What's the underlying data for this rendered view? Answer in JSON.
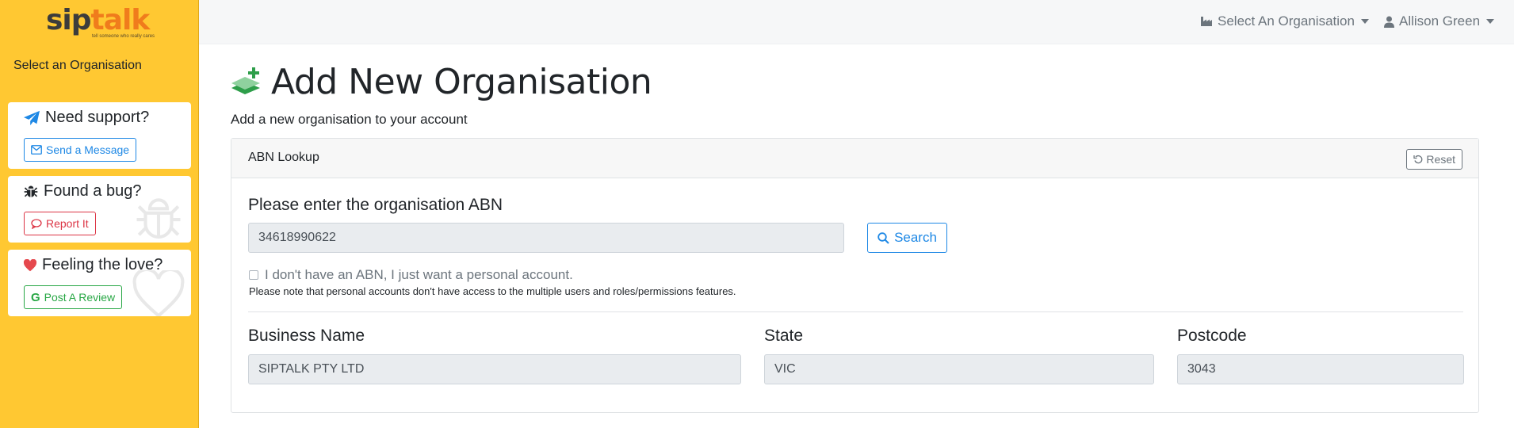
{
  "sidebar": {
    "logo": {
      "sip": "sip",
      "talk": "talk",
      "tagline": "tell someone who really cares"
    },
    "select_org_label": "Select an Organisation",
    "cards": {
      "support": {
        "title": "Need support?",
        "button": "Send a Message"
      },
      "bug": {
        "title": "Found a bug?",
        "button": "Report It"
      },
      "love": {
        "title": "Feeling the love?",
        "button": "Post A Review"
      }
    }
  },
  "topnav": {
    "org_menu": "Select An Organisation",
    "user_menu": "Allison Green"
  },
  "main": {
    "title": "Add New Organisation",
    "subtitle": "Add a new organisation to your account",
    "panel": {
      "header": "ABN Lookup",
      "reset_label": "Reset",
      "abn_heading": "Please enter the organisation ABN",
      "abn_value": "34618990622",
      "search_label": "Search",
      "no_abn_label": "I don't have an ABN, I just want a personal account.",
      "note": "Please note that personal accounts don't have access to the multiple users and roles/permissions features.",
      "fields": {
        "business_name": {
          "label": "Business Name",
          "value": "SIPTALK PTY LTD"
        },
        "state": {
          "label": "State",
          "value": "VIC"
        },
        "postcode": {
          "label": "Postcode",
          "value": "3043"
        }
      }
    }
  },
  "colors": {
    "sidebar_bg": "#ffc832",
    "accent_blue": "#1e88e5",
    "danger_red": "#dc3545",
    "success_green": "#28a745",
    "logo_orange": "#f07c1c"
  },
  "icons": {
    "support": "paper-plane-icon",
    "bug": "bug-icon",
    "love": "heart-icon",
    "message": "envelope-icon",
    "report": "comment-icon",
    "review": "google-icon",
    "org_menu": "industry-icon",
    "user_menu": "user-icon",
    "title": "layer-plus-icon",
    "reset": "undo-icon",
    "search": "search-icon"
  }
}
